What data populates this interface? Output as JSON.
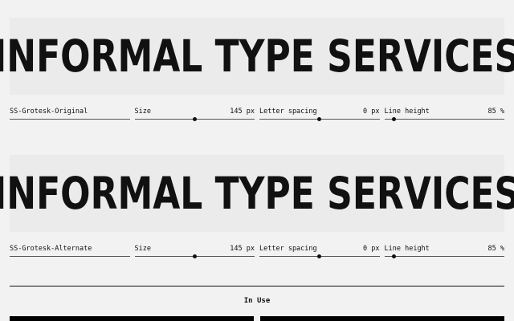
{
  "specimen_text": "INFORMAL TYPE SERVICES",
  "rows": [
    {
      "font_name": "SS-Grotesk-Original",
      "size_label": "Size",
      "size_value": "145 px",
      "size_level": 0.5,
      "spacing_label": "Letter spacing",
      "spacing_value": "0 px",
      "spacing_level": 0.5,
      "lineheight_label": "Line height",
      "lineheight_value": "85 %",
      "lineheight_level": 0.08
    },
    {
      "font_name": "SS-Grotesk-Alternate",
      "size_label": "Size",
      "size_value": "145 px",
      "size_level": 0.5,
      "spacing_label": "Letter spacing",
      "spacing_value": "0 px",
      "spacing_level": 0.5,
      "lineheight_label": "Line height",
      "lineheight_value": "85 %",
      "lineheight_level": 0.08
    }
  ],
  "in_use": {
    "title": "In Use"
  },
  "colors": {
    "background": "#f2f2f2",
    "specimen_bg": "#ebebeb",
    "text": "#111111"
  }
}
